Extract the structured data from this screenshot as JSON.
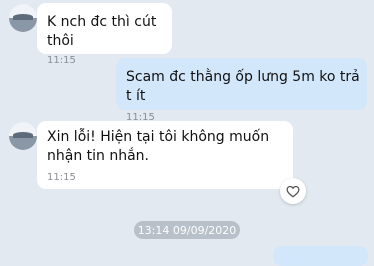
{
  "messages": [
    {
      "side": "left",
      "text": "K nch đc thì cút thôi",
      "time": "11:15"
    },
    {
      "side": "right",
      "text": "Scam đc thằng ốp lưng 5m ko trả t ít",
      "time": "11:15"
    },
    {
      "side": "left",
      "text": "Xin lỗi! Hiện tại tôi không muốn nhận tin nhắn.",
      "time": "11:15",
      "reaction_icon": "heart-outline-icon"
    }
  ],
  "date_separator": "13:14 09/09/2020",
  "colors": {
    "background": "#e2e9f1",
    "incoming": "#ffffff",
    "outgoing": "#d3e7fb"
  }
}
